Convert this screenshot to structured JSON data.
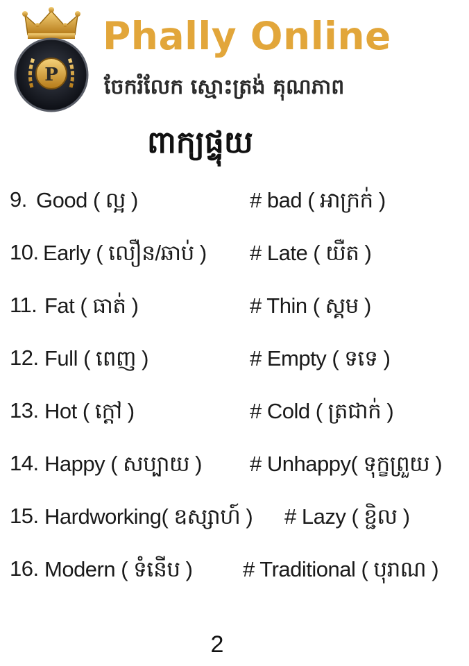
{
  "header": {
    "brand_title": "Phally Online",
    "tagline": "ចែករំលែក ស្មោះត្រង់ គុណភាព",
    "logo_letter": "P",
    "accent_color": "#e2a63a"
  },
  "section_title": "ពាក្យផ្ទុយ",
  "pairs": [
    {
      "num": "9.",
      "left": "Good ( ល្អ )",
      "right": "# bad ( អាក្រក់ )"
    },
    {
      "num": "10.",
      "left": "Early  ( លឿន/ឆាប់ )",
      "right": "# Late ( យឺត )"
    },
    {
      "num": "11.",
      "left": "Fat ( ធាត់ )",
      "right": "# Thin ( ស្គម )"
    },
    {
      "num": "12.",
      "left": "Full ( ពេញ )",
      "right": "# Empty ( ទទេ )"
    },
    {
      "num": "13.",
      "left": "Hot ( ក្តៅ )",
      "right": "# Cold ( ត្រជាក់ )"
    },
    {
      "num": "14.",
      "left": "Happy ( សប្បាយ )",
      "right": "# Unhappy( ទុក្ខព្រួយ )"
    },
    {
      "num": "15.",
      "left": "Hardworking( ឧស្សាហ៍ )",
      "right": "# Lazy ( ខ្ជិល )"
    },
    {
      "num": "16.",
      "left": "Modern ( ទំនើប )",
      "right": "# Traditional ( បុរាណ )"
    }
  ],
  "page_number": "2"
}
